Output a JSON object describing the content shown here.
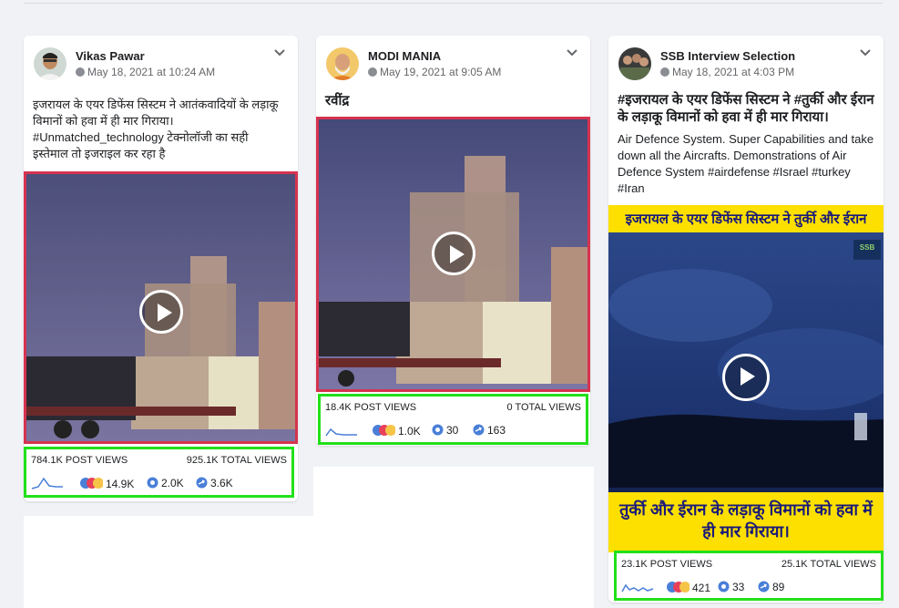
{
  "posts": [
    {
      "author": "Vikas Pawar",
      "date": "May 18, 2021 at 10:24 AM",
      "text": "इजरायल के एयर डिफेंस सिस्टम ने आतंकवादियों के लड़ाकू विमानों को हवा में ही मार गिराया। #Unmatched_technology टेक्नोलॉजी का सही इस्तेमाल तो इजराइल कर रहा है",
      "post_views": "784.1K POST VIEWS",
      "total_views": "925.1K TOTAL VIEWS",
      "reactions": "14.9K",
      "comments": "2.0K",
      "shares": "3.6K"
    },
    {
      "author": "MODI MANIA",
      "date": "May 19, 2021 at 9:05 AM",
      "text": "रवींद्र",
      "post_views": "18.4K POST VIEWS",
      "total_views": "0 TOTAL VIEWS",
      "reactions": "1.0K",
      "comments": "30",
      "shares": "163"
    },
    {
      "author": "SSB Interview Selection",
      "date": "May 18, 2021 at 4:03 PM",
      "headline": "#इजरायल के एयर डिफेंस सिस्टम ने #तुर्की और ईरान के लड़ाकू विमानों को हवा में ही मार गिराया।",
      "text": "Air Defence System. Super Capabilities and take down all the Aircrafts. Demonstrations of Air Defence System #airdefense #Israel #turkey #Iran",
      "banner_top": "इजरायल के एयर डिफेंस सिस्टम ने तुर्की और ईरान",
      "banner_bottom": "तुर्की और ईरान के लड़ाकू विमानों को हवा में ही मार गिराया।",
      "logo_text": "SSB",
      "post_views": "23.1K POST VIEWS",
      "total_views": "25.1K TOTAL VIEWS",
      "reactions": "421",
      "comments": "33",
      "shares": "89"
    }
  ],
  "colors": {
    "highlight_video": "#d6334f",
    "highlight_stats": "#22e01a",
    "banner_yellow": "#fde000"
  },
  "icons": [
    "globe-icon",
    "chevron-down-icon",
    "play-icon",
    "sparkline-icon",
    "like-icon",
    "love-icon",
    "haha-icon",
    "comment-icon",
    "share-icon"
  ]
}
